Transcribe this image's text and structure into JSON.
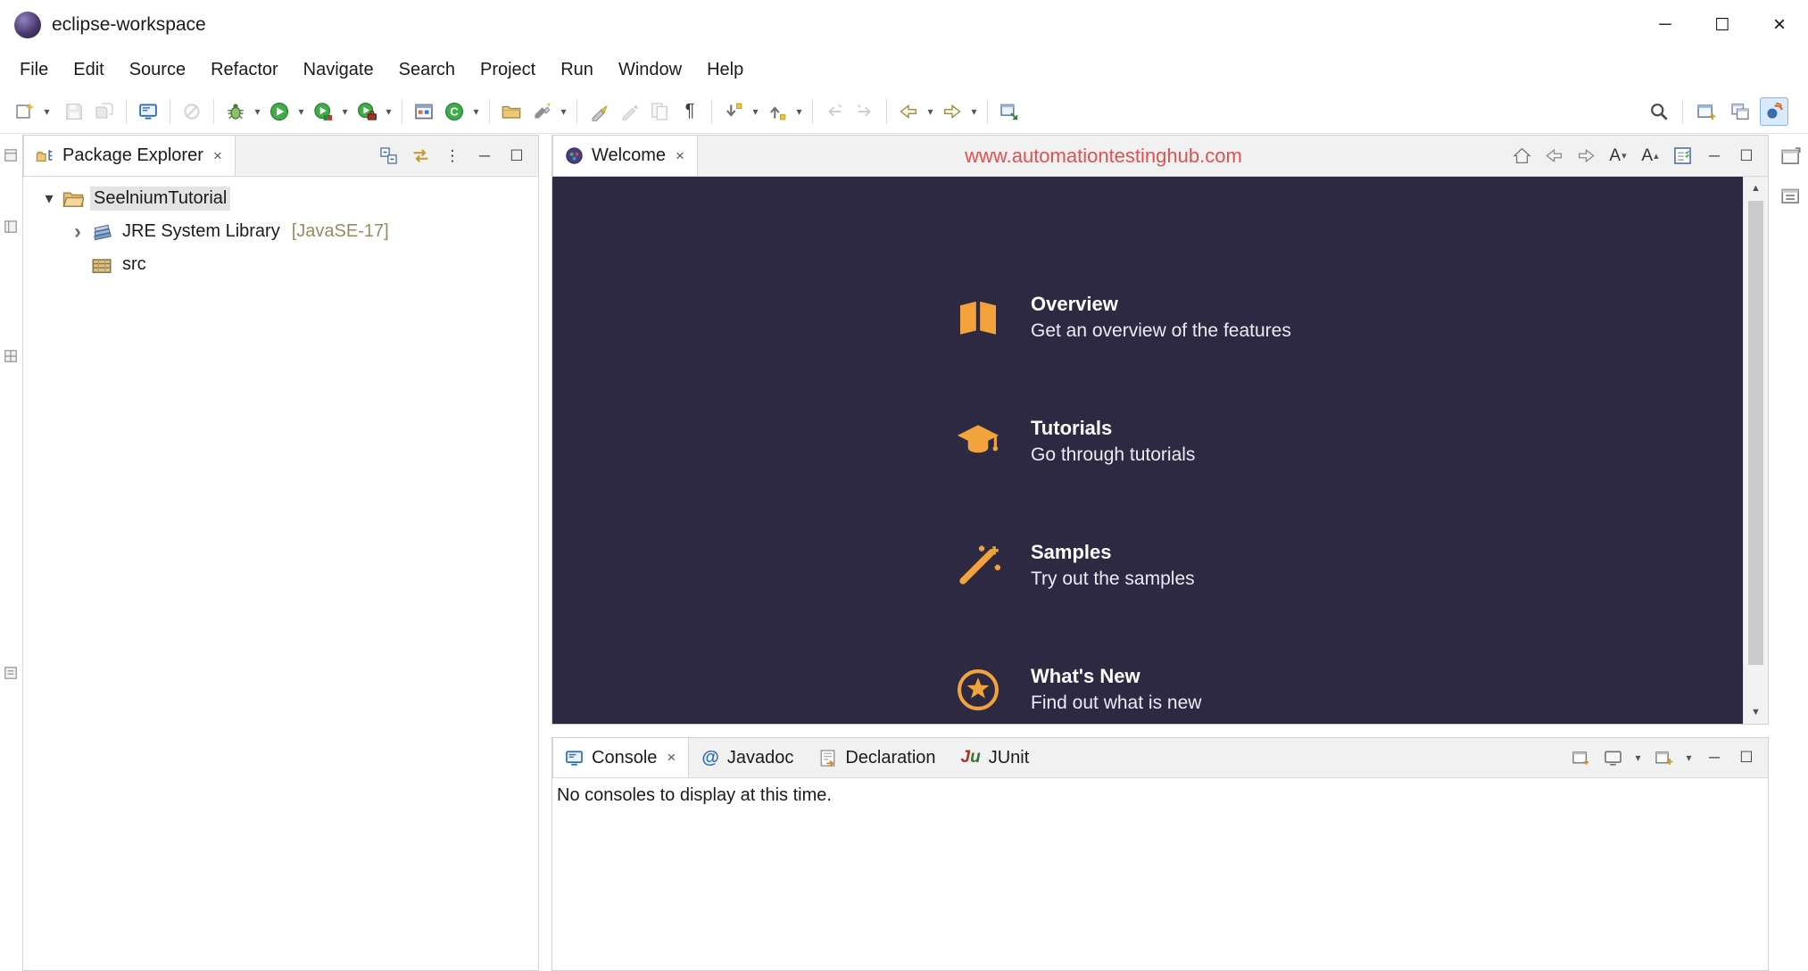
{
  "colors": {
    "welcome_bg": "#2d2943",
    "accent_orange": "#f2a33c",
    "watermark_red": "#e25050",
    "console_blue": "#2e6db4",
    "run_green": "#3fae49",
    "decorator_tan": "#9a8a64"
  },
  "window": {
    "title": "eclipse-workspace",
    "controls": {
      "minimize": "─",
      "maximize": "☐",
      "close": "×"
    }
  },
  "menu": {
    "items": [
      "File",
      "Edit",
      "Source",
      "Refactor",
      "Navigate",
      "Search",
      "Project",
      "Run",
      "Window",
      "Help"
    ]
  },
  "toolbar": {
    "icon_names": [
      "new-wizard",
      "save",
      "save-all",
      "open-console",
      "skip-breakpoints",
      "debug",
      "run",
      "coverage",
      "external-tools",
      "new-java-project",
      "new-class",
      "open-folder",
      "search-flashlight",
      "mark-occurrences",
      "edit",
      "copy-document",
      "show-whitespace",
      "next-annotation",
      "previous-annotation",
      "last-edit-location",
      "next-edit-location",
      "back",
      "forward",
      "pin-editor",
      "search",
      "open-perspective",
      "java-perspective"
    ]
  },
  "glyphs": {
    "close": "×",
    "min": "─",
    "max": "☐",
    "dropdown": "▾",
    "up": "▴",
    "chevron_expanded": "▾",
    "chevron_collapsed": "›",
    "view_menu": "⋮",
    "pilcrow": "¶",
    "at": "@",
    "junit_j": "J",
    "junit_u": "u",
    "class_c": "C",
    "scroll_up": "▲",
    "scroll_down": "▼"
  },
  "package_explorer": {
    "tab_label": "Package Explorer",
    "tree": {
      "project_label": "SeelniumTutorial",
      "jre_label": "JRE System Library",
      "jre_decorator": "[JavaSE-17]",
      "src_label": "src"
    }
  },
  "editor": {
    "tab_label": "Welcome",
    "watermark": "www.automationtestinghub.com",
    "font_buttons": {
      "decrease": "A",
      "increase": "A"
    },
    "welcome_items": [
      {
        "title": "Overview",
        "subtitle": "Get an overview of the features"
      },
      {
        "title": "Tutorials",
        "subtitle": "Go through tutorials"
      },
      {
        "title": "Samples",
        "subtitle": "Try out the samples"
      },
      {
        "title": "What's New",
        "subtitle": "Find out what is new"
      }
    ]
  },
  "console": {
    "tabs": [
      "Console",
      "Javadoc",
      "Declaration",
      "JUnit"
    ],
    "message": "No consoles to display at this time."
  }
}
